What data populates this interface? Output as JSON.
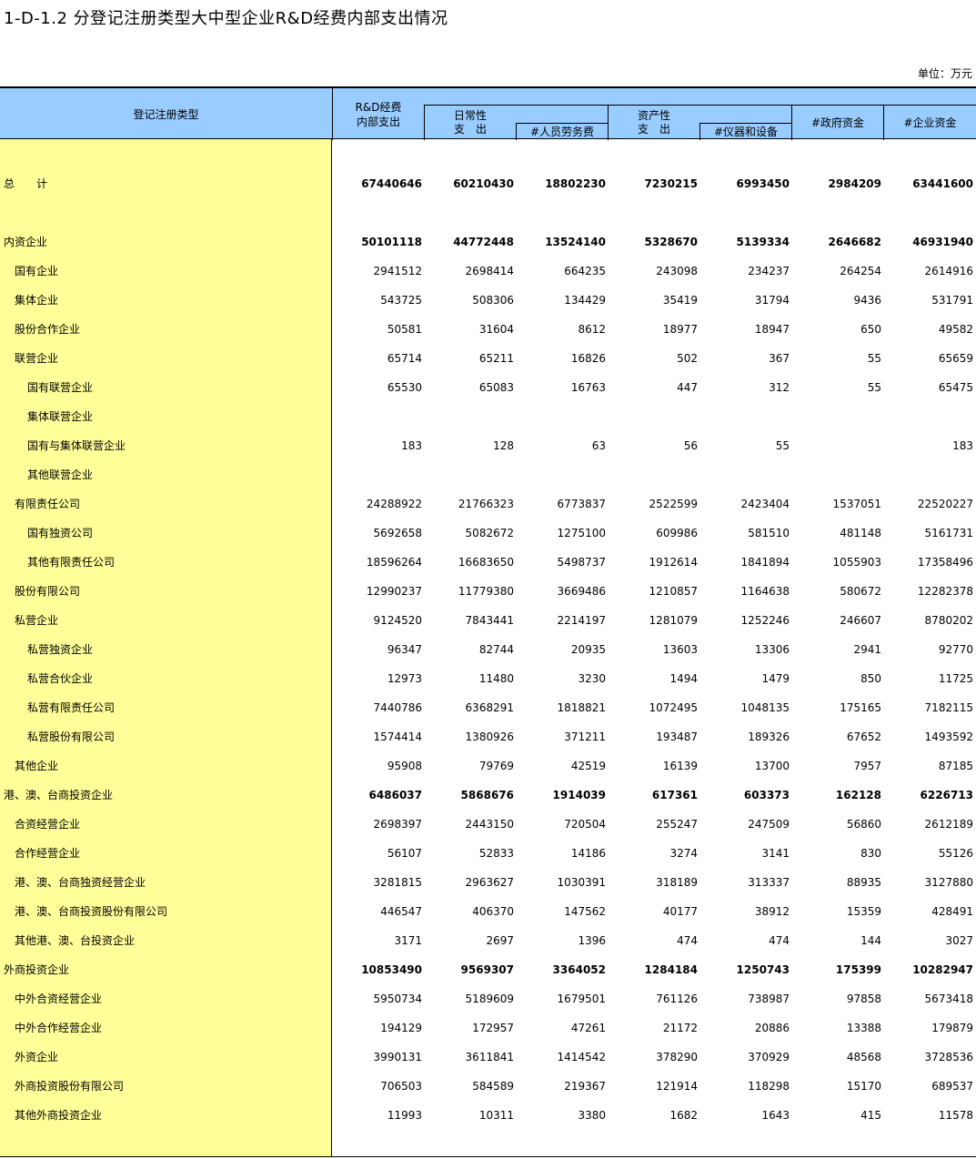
{
  "title": "1-D-1.2   分登记注册类型大中型企业R&D经费内部支出情况",
  "unit": "单位：万元",
  "header": {
    "stub": "登记注册类型",
    "col_rd_line1": "R&D经费",
    "col_rd_line2": "内部支出",
    "col_daily_line1": "日常性",
    "col_daily_line2": "支　出",
    "col_labor": "#人员劳务费",
    "col_asset_line1": "资产性",
    "col_asset_line2": "支　出",
    "col_equip": "#仪器和设备",
    "col_gov": "#政府资金",
    "col_ent": "#企业资金"
  },
  "rows": [
    {
      "label": "总　　计",
      "indent": 0,
      "bold": true,
      "values": [
        "67440646",
        "60210430",
        "18802230",
        "7230215",
        "6993450",
        "2984209",
        "63441600"
      ]
    },
    {
      "label": "内资企业",
      "indent": 0,
      "bold": true,
      "values": [
        "50101118",
        "44772448",
        "13524140",
        "5328670",
        "5139334",
        "2646682",
        "46931940"
      ]
    },
    {
      "label": "国有企业",
      "indent": 1,
      "bold": false,
      "values": [
        "2941512",
        "2698414",
        "664235",
        "243098",
        "234237",
        "264254",
        "2614916"
      ]
    },
    {
      "label": "集体企业",
      "indent": 1,
      "bold": false,
      "values": [
        "543725",
        "508306",
        "134429",
        "35419",
        "31794",
        "9436",
        "531791"
      ]
    },
    {
      "label": "股份合作企业",
      "indent": 1,
      "bold": false,
      "values": [
        "50581",
        "31604",
        "8612",
        "18977",
        "18947",
        "650",
        "49582"
      ]
    },
    {
      "label": "联营企业",
      "indent": 1,
      "bold": false,
      "values": [
        "65714",
        "65211",
        "16826",
        "502",
        "367",
        "55",
        "65659"
      ]
    },
    {
      "label": "国有联营企业",
      "indent": 2,
      "bold": false,
      "values": [
        "65530",
        "65083",
        "16763",
        "447",
        "312",
        "55",
        "65475"
      ]
    },
    {
      "label": "集体联营企业",
      "indent": 2,
      "bold": false,
      "values": [
        "",
        "",
        "",
        "",
        "",
        "",
        ""
      ]
    },
    {
      "label": "国有与集体联营企业",
      "indent": 2,
      "bold": false,
      "values": [
        "183",
        "128",
        "63",
        "56",
        "55",
        "",
        "183"
      ]
    },
    {
      "label": "其他联营企业",
      "indent": 2,
      "bold": false,
      "values": [
        "",
        "",
        "",
        "",
        "",
        "",
        ""
      ]
    },
    {
      "label": "有限责任公司",
      "indent": 1,
      "bold": false,
      "values": [
        "24288922",
        "21766323",
        "6773837",
        "2522599",
        "2423404",
        "1537051",
        "22520227"
      ]
    },
    {
      "label": "国有独资公司",
      "indent": 2,
      "bold": false,
      "values": [
        "5692658",
        "5082672",
        "1275100",
        "609986",
        "581510",
        "481148",
        "5161731"
      ]
    },
    {
      "label": "其他有限责任公司",
      "indent": 2,
      "bold": false,
      "values": [
        "18596264",
        "16683650",
        "5498737",
        "1912614",
        "1841894",
        "1055903",
        "17358496"
      ]
    },
    {
      "label": "股份有限公司",
      "indent": 1,
      "bold": false,
      "values": [
        "12990237",
        "11779380",
        "3669486",
        "1210857",
        "1164638",
        "580672",
        "12282378"
      ]
    },
    {
      "label": "私营企业",
      "indent": 1,
      "bold": false,
      "values": [
        "9124520",
        "7843441",
        "2214197",
        "1281079",
        "1252246",
        "246607",
        "8780202"
      ]
    },
    {
      "label": "私营独资企业",
      "indent": 2,
      "bold": false,
      "values": [
        "96347",
        "82744",
        "20935",
        "13603",
        "13306",
        "2941",
        "92770"
      ]
    },
    {
      "label": "私营合伙企业",
      "indent": 2,
      "bold": false,
      "values": [
        "12973",
        "11480",
        "3230",
        "1494",
        "1479",
        "850",
        "11725"
      ]
    },
    {
      "label": "私营有限责任公司",
      "indent": 2,
      "bold": false,
      "values": [
        "7440786",
        "6368291",
        "1818821",
        "1072495",
        "1048135",
        "175165",
        "7182115"
      ]
    },
    {
      "label": "私营股份有限公司",
      "indent": 2,
      "bold": false,
      "values": [
        "1574414",
        "1380926",
        "371211",
        "193487",
        "189326",
        "67652",
        "1493592"
      ]
    },
    {
      "label": "其他企业",
      "indent": 1,
      "bold": false,
      "values": [
        "95908",
        "79769",
        "42519",
        "16139",
        "13700",
        "7957",
        "87185"
      ]
    },
    {
      "label": "港、澳、台商投资企业",
      "indent": 0,
      "bold": true,
      "values": [
        "6486037",
        "5868676",
        "1914039",
        "617361",
        "603373",
        "162128",
        "6226713"
      ]
    },
    {
      "label": "合资经营企业",
      "indent": 1,
      "bold": false,
      "values": [
        "2698397",
        "2443150",
        "720504",
        "255247",
        "247509",
        "56860",
        "2612189"
      ]
    },
    {
      "label": "合作经营企业",
      "indent": 1,
      "bold": false,
      "values": [
        "56107",
        "52833",
        "14186",
        "3274",
        "3141",
        "830",
        "55126"
      ]
    },
    {
      "label": "港、澳、台商独资经营企业",
      "indent": 1,
      "bold": false,
      "values": [
        "3281815",
        "2963627",
        "1030391",
        "318189",
        "313337",
        "88935",
        "3127880"
      ]
    },
    {
      "label": "港、澳、台商投资股份有限公司",
      "indent": 1,
      "bold": false,
      "values": [
        "446547",
        "406370",
        "147562",
        "40177",
        "38912",
        "15359",
        "428491"
      ]
    },
    {
      "label": "其他港、澳、台投资企业",
      "indent": 1,
      "bold": false,
      "values": [
        "3171",
        "2697",
        "1396",
        "474",
        "474",
        "144",
        "3027"
      ]
    },
    {
      "label": "外商投资企业",
      "indent": 0,
      "bold": true,
      "values": [
        "10853490",
        "9569307",
        "3364052",
        "1284184",
        "1250743",
        "175399",
        "10282947"
      ]
    },
    {
      "label": "中外合资经营企业",
      "indent": 1,
      "bold": false,
      "values": [
        "5950734",
        "5189609",
        "1679501",
        "761126",
        "738987",
        "97858",
        "5673418"
      ]
    },
    {
      "label": "中外合作经营企业",
      "indent": 1,
      "bold": false,
      "values": [
        "194129",
        "172957",
        "47261",
        "21172",
        "20886",
        "13388",
        "179879"
      ]
    },
    {
      "label": "外资企业",
      "indent": 1,
      "bold": false,
      "values": [
        "3990131",
        "3611841",
        "1414542",
        "378290",
        "370929",
        "48568",
        "3728536"
      ]
    },
    {
      "label": "外商投资股份有限公司",
      "indent": 1,
      "bold": false,
      "values": [
        "706503",
        "584589",
        "219367",
        "121914",
        "118298",
        "15170",
        "689537"
      ]
    },
    {
      "label": "其他外商投资企业",
      "indent": 1,
      "bold": false,
      "values": [
        "11993",
        "10311",
        "3380",
        "1682",
        "1643",
        "415",
        "11578"
      ]
    }
  ]
}
